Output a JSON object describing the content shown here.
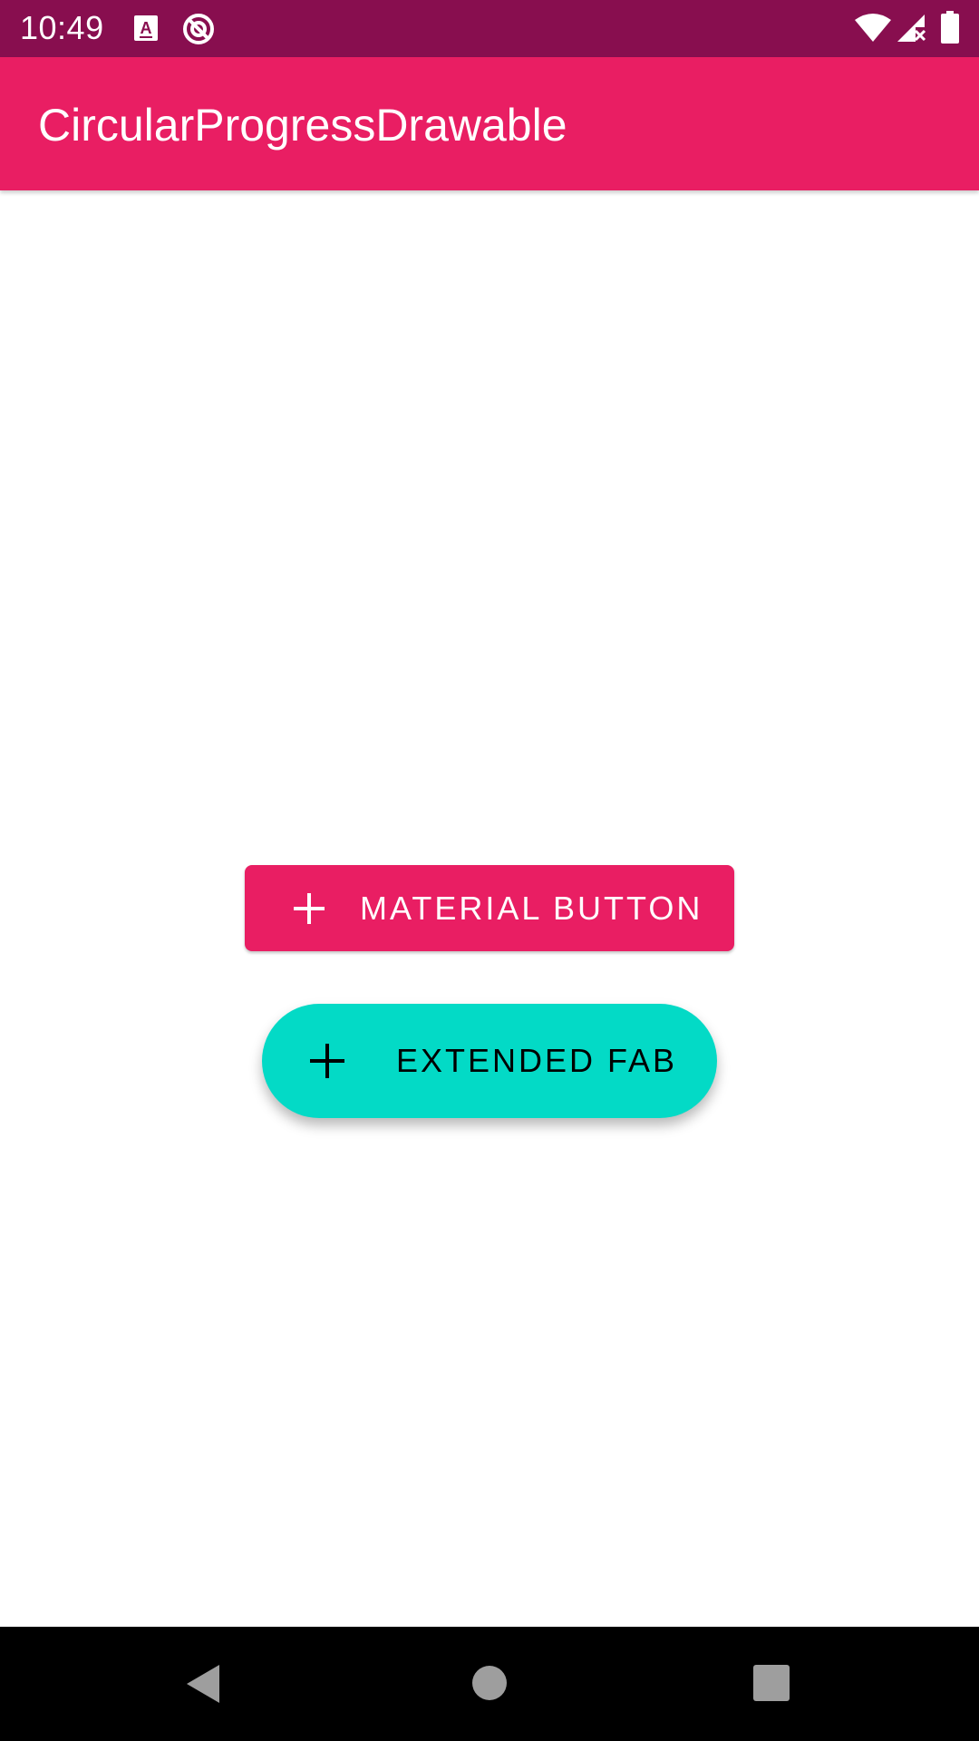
{
  "status_bar": {
    "time": "10:49",
    "icons": [
      "notification-a-icon",
      "sync-disabled-icon",
      "wifi-icon",
      "cell-signal-icon",
      "battery-icon"
    ]
  },
  "app_bar": {
    "title": "CircularProgressDrawable"
  },
  "main": {
    "material_button": {
      "label": "MATERIAL BUTTON",
      "icon": "plus-icon",
      "color": "#e91e63"
    },
    "extended_fab": {
      "label": "EXTENDED FAB",
      "icon": "plus-icon",
      "color": "#03dac6"
    }
  },
  "nav_bar": {
    "buttons": [
      "back-icon",
      "home-icon",
      "recents-icon"
    ]
  },
  "colors": {
    "status_bar": "#880e4f",
    "primary": "#e91e63",
    "secondary": "#03dac6"
  }
}
